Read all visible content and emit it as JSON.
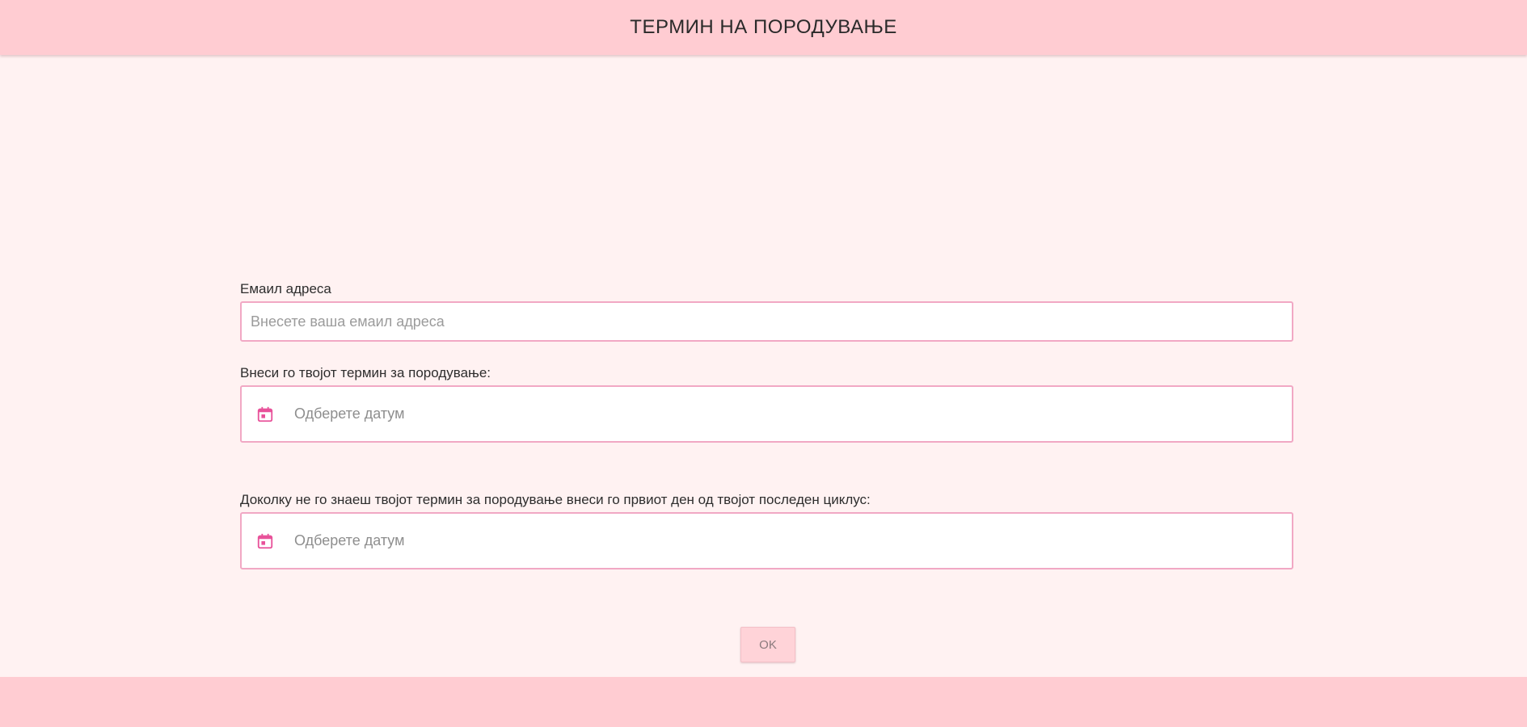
{
  "header": {
    "title": "ТЕРМИН НА ПОРОДУВАЊЕ"
  },
  "form": {
    "email": {
      "label": "Емаил адреса",
      "placeholder": "Внесете ваша емаил адреса",
      "value": ""
    },
    "due_date": {
      "label": "Внеси го твојот термин за породување:",
      "placeholder": "Одберете датум",
      "icon": "calendar-icon"
    },
    "last_period": {
      "label": "Доколку не го знаеш твојот термин за породување внеси го првиот ден од твојот последен циклус:",
      "placeholder": "Одберете датум",
      "icon": "calendar-icon"
    },
    "ok_label": "OK"
  },
  "colors": {
    "header_bg": "#ffccd2",
    "page_bg": "#fff2f2",
    "accent": "#e8529a",
    "input_border": "#f1a8c4"
  }
}
